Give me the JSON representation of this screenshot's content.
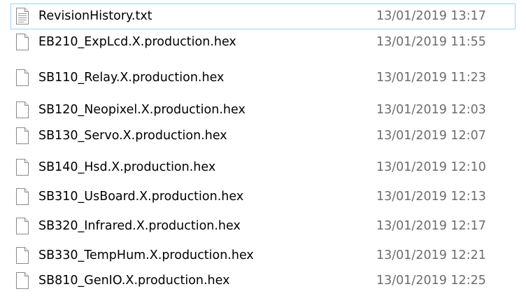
{
  "file_list": {
    "rows": [
      {
        "name": "RevisionHistory.txt",
        "modified": "13/01/2019 13:17",
        "icon": "text-file-icon",
        "focused": true
      },
      {
        "name": "EB210_ExpLcd.X.production.hex",
        "modified": "13/01/2019 11:55",
        "icon": "file-icon"
      },
      {
        "name": "SB110_Relay.X.production.hex",
        "modified": "13/01/2019 11:23",
        "icon": "file-icon"
      },
      {
        "name": "SB120_Neopixel.X.production.hex",
        "modified": "13/01/2019 12:03",
        "icon": "file-icon"
      },
      {
        "name": "SB130_Servo.X.production.hex",
        "modified": "13/01/2019 12:07",
        "icon": "file-icon"
      },
      {
        "name": "SB140_Hsd.X.production.hex",
        "modified": "13/01/2019 12:10",
        "icon": "file-icon"
      },
      {
        "name": "SB310_UsBoard.X.production.hex",
        "modified": "13/01/2019 12:13",
        "icon": "file-icon"
      },
      {
        "name": "SB320_Infrared.X.production.hex",
        "modified": "13/01/2019 12:17",
        "icon": "file-icon"
      },
      {
        "name": "SB330_TempHum.X.production.hex",
        "modified": "13/01/2019 12:21",
        "icon": "file-icon"
      },
      {
        "name": "SB810_GenIO.X.production.hex",
        "modified": "13/01/2019 12:25",
        "icon": "file-icon"
      }
    ],
    "colors": {
      "focus_border": "#99d1ff",
      "name_text": "#000000",
      "date_text": "#6d6d6d"
    }
  }
}
